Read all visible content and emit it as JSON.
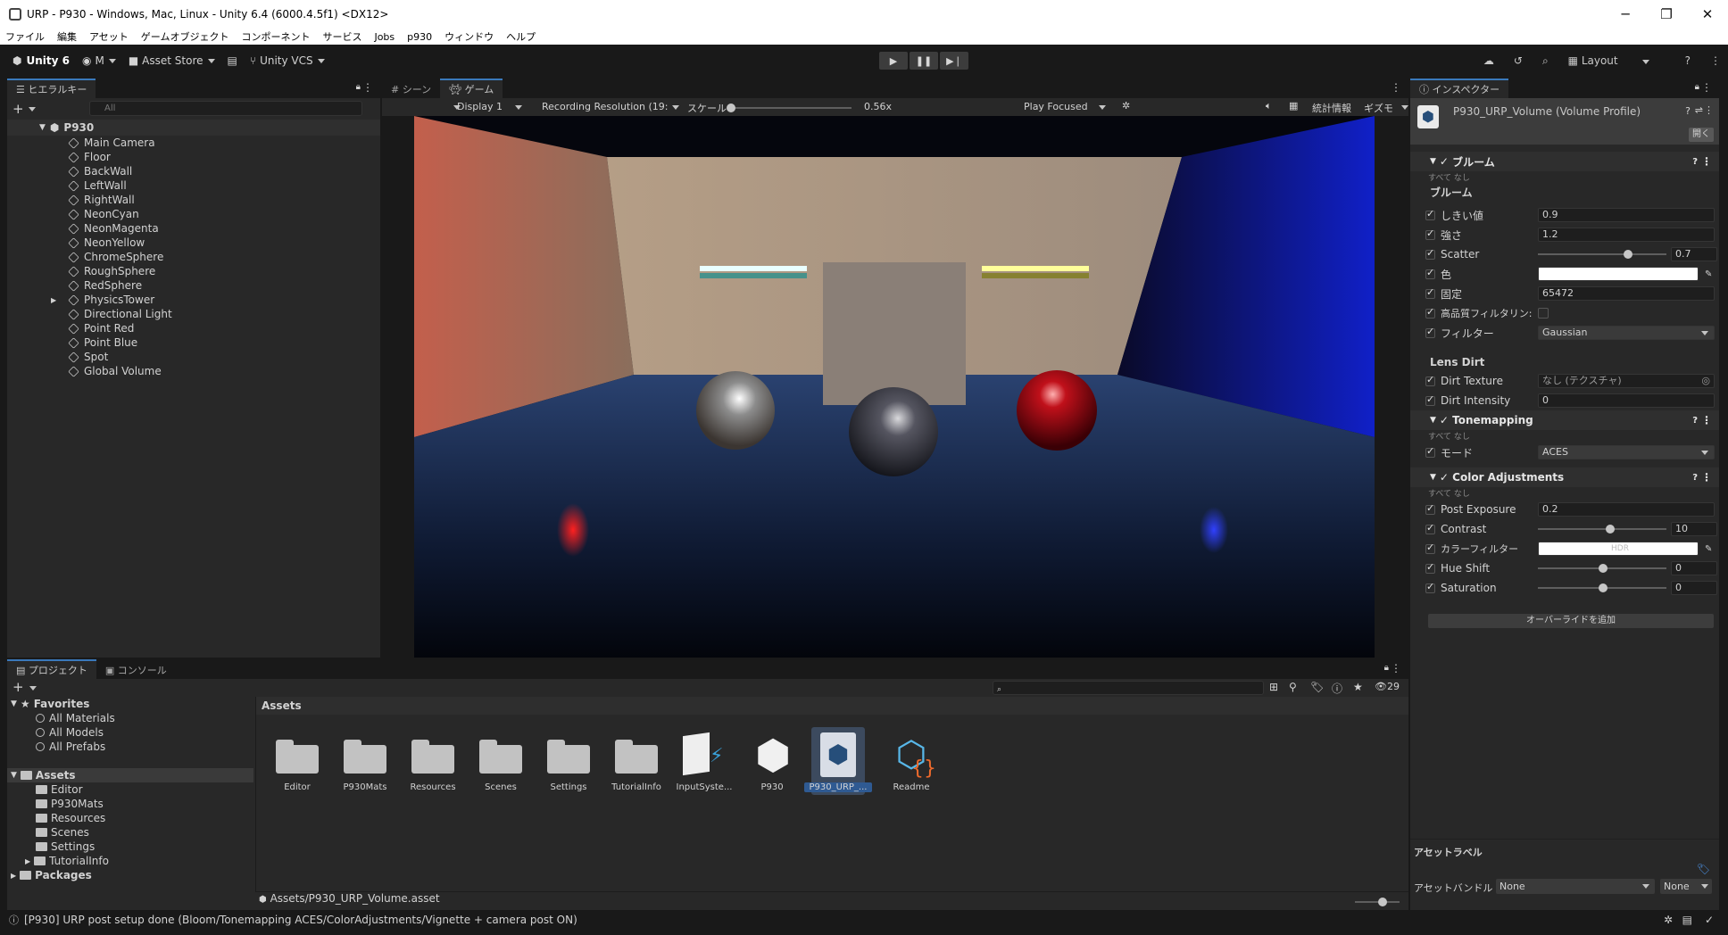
{
  "window": {
    "title": "URP - P930 - Windows, Mac, Linux - Unity 6.4 (6000.4.5f1) <DX12>",
    "minimize": "─",
    "maximize": "❐",
    "close": "✕"
  },
  "menu": [
    "ファイル",
    "編集",
    "アセット",
    "ゲームオブジェクト",
    "コンポーネント",
    "サービス",
    "Jobs",
    "p930",
    "ウィンドウ",
    "ヘルプ"
  ],
  "toolbar": {
    "unity": "Unity 6",
    "account": "M",
    "asset_store": "Asset Store",
    "vcs": "Unity VCS",
    "layout": "Layout"
  },
  "hierarchy": {
    "tab": "ヒエラルキー",
    "search_placeholder": "All",
    "scene": "P930",
    "items": [
      "Main Camera",
      "Floor",
      "BackWall",
      "LeftWall",
      "RightWall",
      "NeonCyan",
      "NeonMagenta",
      "NeonYellow",
      "ChromeSphere",
      "RoughSphere",
      "RedSphere",
      "PhysicsTower",
      "Directional Light",
      "Point Red",
      "Point Blue",
      "Spot",
      "Global Volume"
    ]
  },
  "scene_tabs": {
    "scene": "シーン",
    "game": "ゲーム"
  },
  "game_toolbar": {
    "display": "Display 1",
    "resolution": "Recording Resolution (19:",
    "scale_label": "スケール",
    "scale_value": "0.56x",
    "play_mode": "Play Focused",
    "stats": "統計情報",
    "gizmos": "ギズモ"
  },
  "inspector": {
    "tab": "インスペクター",
    "title": "P930_URP_Volume (Volume Profile)",
    "open_button": "開く",
    "bloom": {
      "header": "ブルーム",
      "all_none": "すべて  なし",
      "group": "ブルーム",
      "rows": [
        {
          "label": "しきい値",
          "value": "0.9"
        },
        {
          "label": "強さ",
          "value": "1.2"
        },
        {
          "label": "Scatter",
          "value": "0.7",
          "slider": 0.7
        },
        {
          "label": "色",
          "value": ""
        },
        {
          "label": "固定",
          "value": "65472"
        },
        {
          "label": "高品質フィルタリン:",
          "value": ""
        },
        {
          "label": "フィルター",
          "value": "Gaussian"
        }
      ],
      "lens_group": "Lens Dirt",
      "lens_rows": [
        {
          "label": "Dirt Texture",
          "value": "なし (テクスチャ)"
        },
        {
          "label": "Dirt Intensity",
          "value": "0"
        }
      ]
    },
    "tonemapping": {
      "header": "Tonemapping",
      "all_none": "すべて  なし",
      "mode_label": "モード",
      "mode_value": "ACES"
    },
    "color_adj": {
      "header": "Color Adjustments",
      "all_none": "すべて  なし",
      "rows": [
        {
          "label": "Post Exposure",
          "value": "0.2"
        },
        {
          "label": "Contrast",
          "value": "10",
          "slider": 0.55
        },
        {
          "label": "カラーフィルター",
          "value": "HDR"
        },
        {
          "label": "Hue Shift",
          "value": "0",
          "slider": 0.5
        },
        {
          "label": "Saturation",
          "value": "0",
          "slider": 0.5
        }
      ]
    },
    "add_override": "オーバーライドを追加",
    "asset_labels": "アセットラベル",
    "asset_bundle_label": "アセットバンドル",
    "asset_bundle_value": "None",
    "asset_bundle_variant": "None"
  },
  "project": {
    "tab_project": "プロジェクト",
    "tab_console": "コンソール",
    "count": "29",
    "favorites": "Favorites",
    "fav_items": [
      "All Materials",
      "All Models",
      "All Prefabs"
    ],
    "assets": "Assets",
    "asset_folders": [
      "Editor",
      "P930Mats",
      "Resources",
      "Scenes",
      "Settings",
      "TutorialInfo"
    ],
    "packages": "Packages",
    "breadcrumb": "Assets",
    "grid": [
      "Editor",
      "P930Mats",
      "Resources",
      "Scenes",
      "Settings",
      "TutorialInfo",
      "InputSyste...",
      "P930",
      "P930_URP_...",
      "Readme"
    ],
    "footer_path": "Assets/P930_URP_Volume.asset"
  },
  "status": {
    "message": "[P930] URP post setup done (Bloom/Tonemapping ACES/ColorAdjustments/Vignette + camera post ON)"
  }
}
